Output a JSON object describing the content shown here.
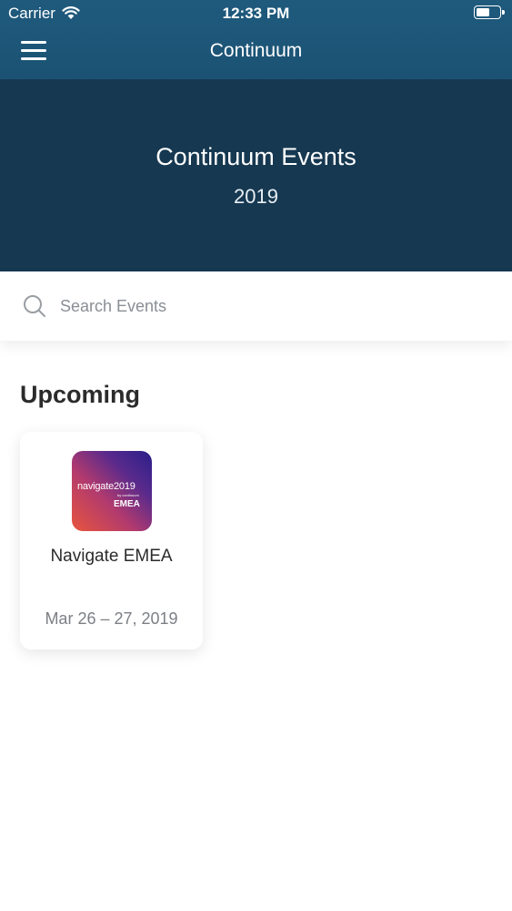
{
  "status_bar": {
    "carrier": "Carrier",
    "time": "12:33 PM",
    "battery_level": 0.6
  },
  "nav": {
    "title": "Continuum",
    "menu_icon": "hamburger-menu-icon"
  },
  "hero": {
    "title": "Continuum Events",
    "subtitle": "2019"
  },
  "search": {
    "placeholder": "Search Events",
    "value": "",
    "icon": "search-icon"
  },
  "sections": {
    "upcoming": {
      "title": "Upcoming",
      "events": [
        {
          "name": "Navigate EMEA",
          "date": "Mar 26 – 27, 2019",
          "logo": {
            "text_main": "navigate2019",
            "text_by": "by continuum",
            "text_region": "EMEA"
          }
        }
      ]
    }
  },
  "colors": {
    "nav_bar": "#1f5a7d",
    "hero_background": "#163851",
    "text_primary": "#2b2b2b",
    "text_secondary": "#7b7f84"
  }
}
